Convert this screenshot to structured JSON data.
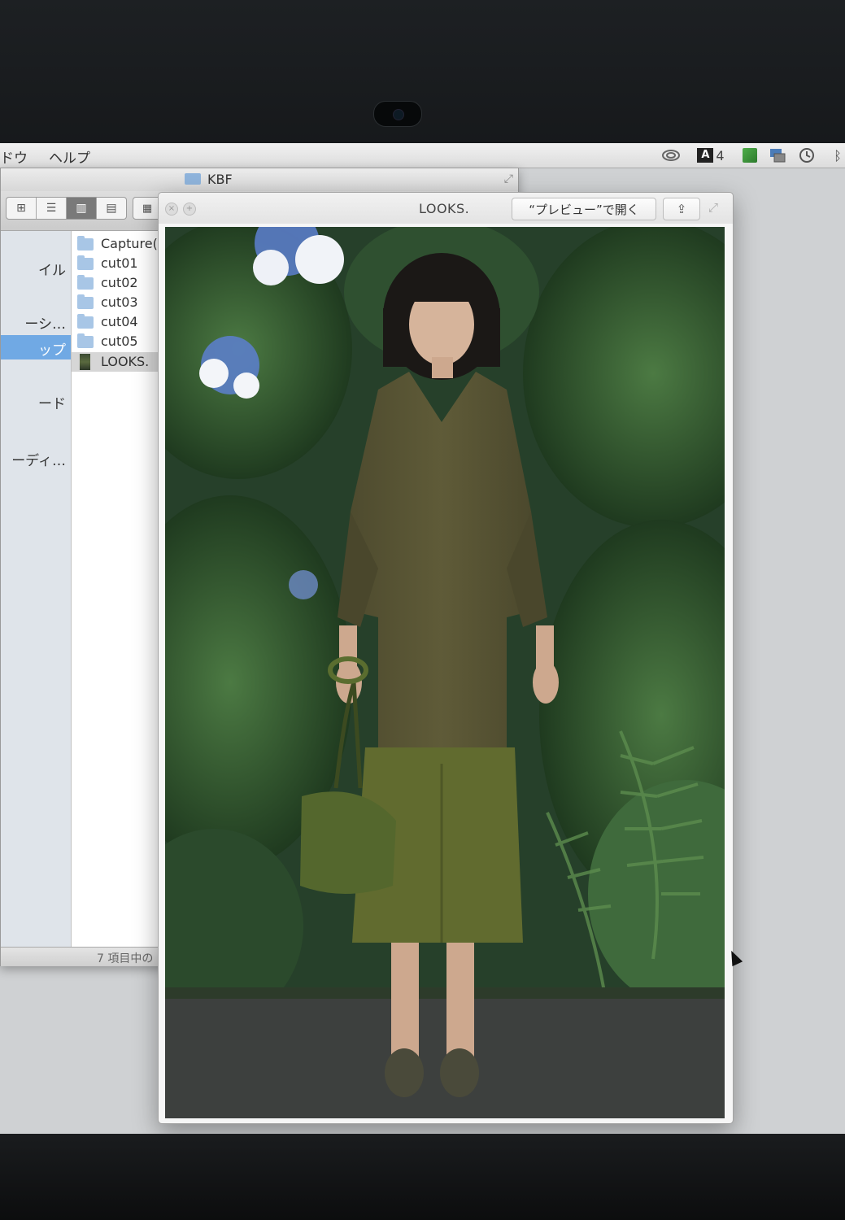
{
  "menubar": {
    "items": [
      "ドウ",
      "ヘルプ"
    ],
    "adobe_count": "4"
  },
  "finder": {
    "title": "KBF",
    "sidebar": [
      "イル",
      "ーシ…",
      "ップ",
      "ード",
      "ーディ…"
    ],
    "files": [
      {
        "name": "Capture(",
        "kind": "folder"
      },
      {
        "name": "cut01",
        "kind": "folder"
      },
      {
        "name": "cut02",
        "kind": "folder"
      },
      {
        "name": "cut03",
        "kind": "folder"
      },
      {
        "name": "cut04",
        "kind": "folder"
      },
      {
        "name": "cut05",
        "kind": "folder"
      },
      {
        "name": "LOOKS.",
        "kind": "image"
      }
    ],
    "status": "7 項目中の"
  },
  "quicklook": {
    "title": "LOOKS.",
    "open_button": "“プレビュー”で開く"
  },
  "icons": {
    "close": "close-icon",
    "fullscreen": "fullscreen-icon",
    "share": "share-icon",
    "expand": "expand-icon"
  },
  "colors": {
    "selection": "#70a9e4",
    "folder": "#a8c6e6"
  }
}
